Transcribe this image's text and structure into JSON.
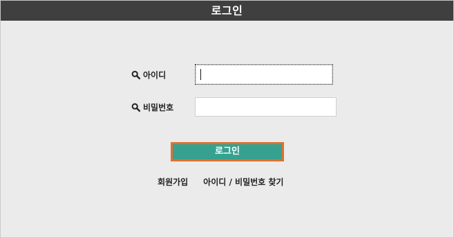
{
  "window": {
    "title": "로그인"
  },
  "form": {
    "id_label": "아이디",
    "id_value": "",
    "password_label": "비밀번호",
    "password_value": "",
    "icon": "search-icon",
    "submit_label": "로그인"
  },
  "links": {
    "signup": "회원가입",
    "find_account": "아이디 / 비밀번호 찾기"
  },
  "colors": {
    "titlebar": "#3f3f3f",
    "background": "#ebebeb",
    "button": "#36a18f",
    "button_border": "#e07030"
  }
}
